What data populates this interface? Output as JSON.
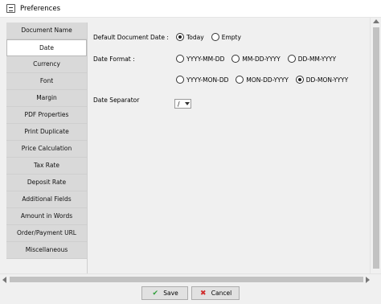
{
  "window": {
    "title": "Preferences"
  },
  "sidebar": {
    "items": [
      {
        "label": "Document Name",
        "active": false
      },
      {
        "label": "Date",
        "active": true
      },
      {
        "label": "Currency",
        "active": false
      },
      {
        "label": "Font",
        "active": false
      },
      {
        "label": "Margin",
        "active": false
      },
      {
        "label": "PDF Properties",
        "active": false
      },
      {
        "label": "Print Duplicate",
        "active": false
      },
      {
        "label": "Price Calculation",
        "active": false
      },
      {
        "label": "Tax Rate",
        "active": false
      },
      {
        "label": "Deposit Rate",
        "active": false
      },
      {
        "label": "Additional Fields",
        "active": false
      },
      {
        "label": "Amount in Words",
        "active": false
      },
      {
        "label": "Order/Payment URL",
        "active": false
      },
      {
        "label": "Miscellaneous",
        "active": false
      }
    ]
  },
  "date": {
    "default_label": "Default Document Date :",
    "default_options": [
      {
        "label": "Today",
        "checked": true
      },
      {
        "label": "Empty",
        "checked": false
      }
    ],
    "format_label": "Date Format :",
    "format_options_row1": [
      {
        "label": "YYYY-MM-DD",
        "checked": false
      },
      {
        "label": "MM-DD-YYYY",
        "checked": false
      },
      {
        "label": "DD-MM-YYYY",
        "checked": false
      }
    ],
    "format_options_row2": [
      {
        "label": "YYYY-MON-DD",
        "checked": false
      },
      {
        "label": "MON-DD-YYYY",
        "checked": false
      },
      {
        "label": "DD-MON-YYYY",
        "checked": true
      }
    ],
    "separator_label": "Date Separator",
    "separator_value": "/"
  },
  "footer": {
    "save_label": "Save",
    "cancel_label": "Cancel",
    "save_icon_color": "#2e9e3a",
    "cancel_icon_color": "#d02b2b"
  }
}
